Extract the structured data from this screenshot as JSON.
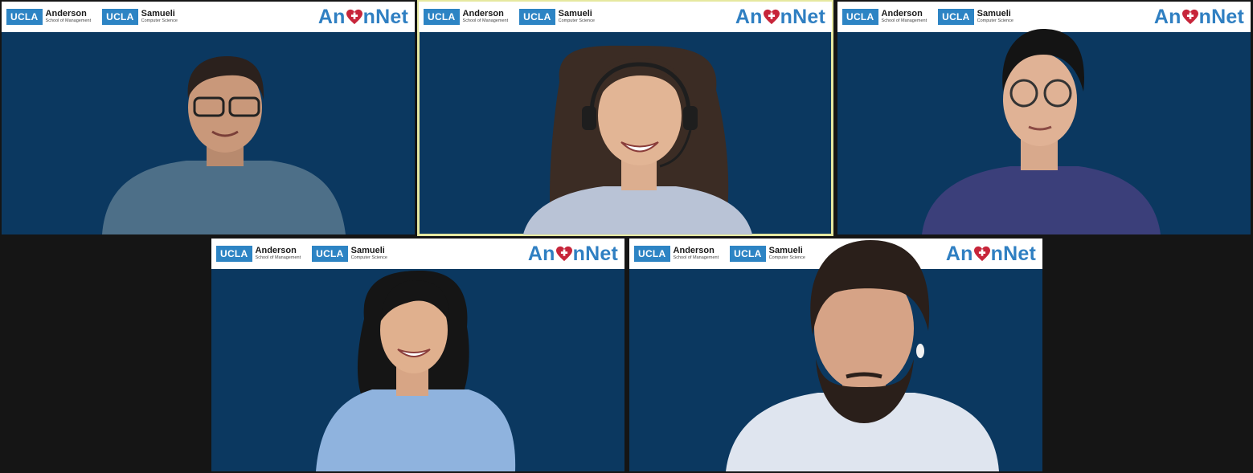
{
  "banner": {
    "logo1_box": "UCLA",
    "logo1_main": "Anderson",
    "logo1_sub": "School of Management",
    "logo2_box": "UCLA",
    "logo2_main": "Samueli",
    "logo2_sub": "Computer Science",
    "brand_prefix": "An",
    "brand_suffix": "nNet"
  },
  "colors": {
    "background": "#151515",
    "tile_bg": "#0b3860",
    "banner_blue": "#2f7fc2",
    "ucla_box": "#2d84c4",
    "heart": "#c7253a",
    "active_border": "#e6e8a0"
  },
  "participants": [
    {
      "id": "p1",
      "active": false
    },
    {
      "id": "p2",
      "active": true
    },
    {
      "id": "p3",
      "active": false
    },
    {
      "id": "p4",
      "active": false
    },
    {
      "id": "p5",
      "active": false
    }
  ]
}
